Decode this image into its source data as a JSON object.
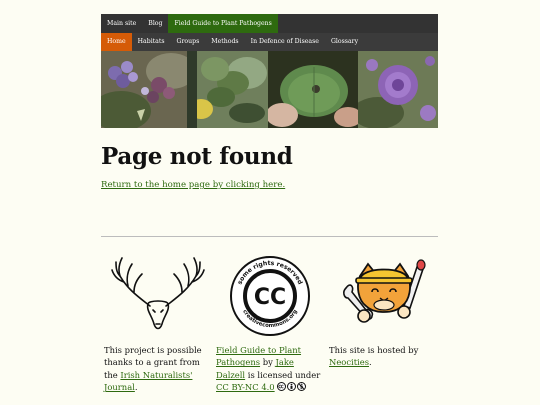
{
  "nav": {
    "top_items": [
      "Main site",
      "Blog",
      "Field Guide to Plant Pathogens"
    ],
    "sub_items": [
      "Home",
      "Habitats",
      "Groups",
      "Methods",
      "In Defence of Disease",
      "Glossary"
    ]
  },
  "main": {
    "title": "Page not found",
    "home_link": "Return to the home page by clicking here."
  },
  "footer": {
    "grant": {
      "text_before": "This project is possible thanks to a grant from the",
      "link": "Irish Naturalists' Journal",
      "text_after": "."
    },
    "license": {
      "guide_link": "Field Guide to Plant Pathogens",
      "by": "by",
      "author_link": "Jake Dalzell",
      "licensed": "is licensed under",
      "license_link": "CC BY-NC 4.0"
    },
    "hosting": {
      "text_before": "This site is hosted by",
      "link": "Neocities",
      "text_after": "."
    },
    "cc_seal": {
      "center": "CC",
      "ring_top": "some rights reserved",
      "ring_bottom": "creativecommons.org"
    }
  },
  "colors": {
    "accent_green": "#2e6a0f",
    "accent_orange": "#d55b07",
    "nav_dark": "#333333",
    "page_bg": "#fdfdf3"
  }
}
